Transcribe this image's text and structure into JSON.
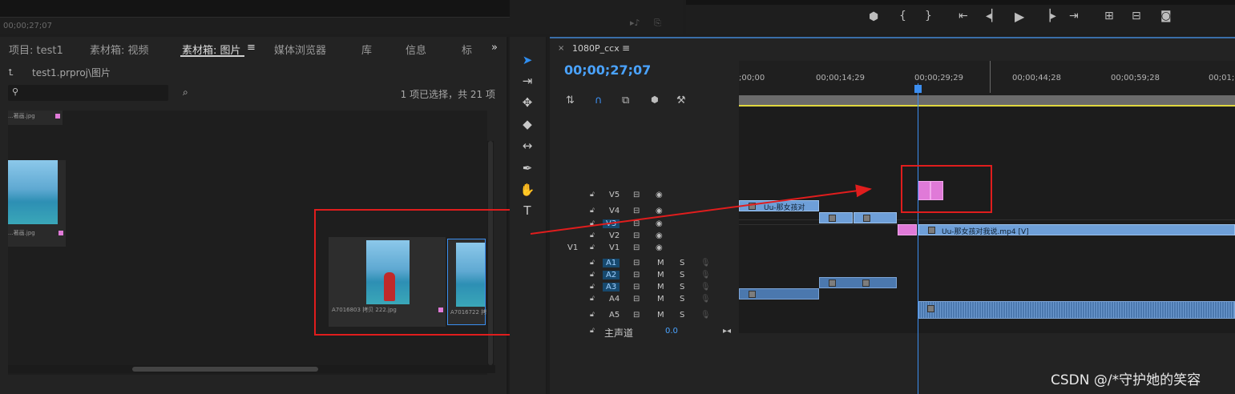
{
  "top": {
    "timecode": "00;00;27;07"
  },
  "project_panel": {
    "tabs": [
      {
        "label": "项目: test1"
      },
      {
        "label": "素材箱: 视频"
      },
      {
        "label": "素材箱: 图片"
      },
      {
        "label": "媒体浏览器"
      },
      {
        "label": "库"
      },
      {
        "label": "信息"
      },
      {
        "label": "标"
      }
    ],
    "menu_icon": "≡",
    "overflow_icon": "»",
    "path": "test1.prproj\\图片",
    "search": {
      "placeholder": "",
      "value": ""
    },
    "item_count": "1 项已选择，共 21 项",
    "thumbnails": [
      {
        "name": "...著画.jpg"
      },
      {
        "name": "...著画.jpg"
      },
      {
        "name": "A7016803 拷贝 222.jpg"
      },
      {
        "name": "A7016722 拷"
      }
    ]
  },
  "timeline": {
    "sequence_name": "1080P_ccx",
    "timecode": "00;00;27;07",
    "ruler_labels": [
      ";00;00",
      "00;00;14;29",
      "00;00;29;29",
      "00;00;44;28",
      "00;00;59;28",
      "00;01;1"
    ],
    "tracks": [
      {
        "name": "V5",
        "type": "video"
      },
      {
        "name": "V4",
        "type": "video"
      },
      {
        "name": "V3",
        "type": "video",
        "highlighted": true
      },
      {
        "name": "V2",
        "type": "video"
      },
      {
        "name": "V1",
        "type": "video",
        "source": "V1"
      },
      {
        "name": "A1",
        "type": "audio",
        "highlighted": true,
        "m": "M",
        "s": "S"
      },
      {
        "name": "A2",
        "type": "audio",
        "highlighted": true,
        "m": "M",
        "s": "S"
      },
      {
        "name": "A3",
        "type": "audio",
        "highlighted": true,
        "m": "M",
        "s": "S"
      },
      {
        "name": "A4",
        "type": "audio",
        "m": "M",
        "s": "S"
      },
      {
        "name": "A5",
        "type": "audio",
        "m": "M",
        "s": "S"
      }
    ],
    "master": {
      "label": "主声道",
      "value": "0.0"
    },
    "clips": {
      "v4_clip": "Uu-那女孩对",
      "v1_clip": "Uu-那女孩对我说.mp4 [V]"
    }
  },
  "watermark": "CSDN @/*守护她的笑容",
  "colors": {
    "accent": "#3c8ef0",
    "annotation_red": "#e01d1d",
    "clip_pink": "#e07ad8",
    "clip_video": "#6e9fd8"
  }
}
